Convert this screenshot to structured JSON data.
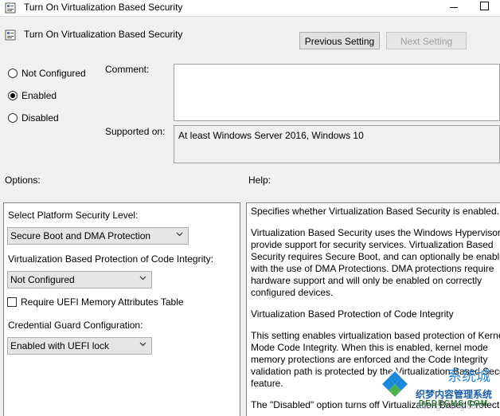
{
  "window": {
    "title": "Turn On Virtualization Based Security"
  },
  "header": {
    "title": "Turn On Virtualization Based Security",
    "prev_button": "Previous Setting",
    "next_button": "Next Setting"
  },
  "state": {
    "options": [
      "Not Configured",
      "Enabled",
      "Disabled"
    ],
    "selected": "Enabled"
  },
  "comment": {
    "label": "Comment:",
    "value": ""
  },
  "supported": {
    "label": "Supported on:",
    "value": "At least Windows Server 2016, Windows 10"
  },
  "options_pane": {
    "heading": "Options:",
    "platform_label": "Select Platform Security Level:",
    "platform_value": "Secure Boot and DMA Protection",
    "vbp_label": "Virtualization Based Protection of Code Integrity:",
    "vbp_value": "Not Configured",
    "uefi_checkbox_label": "Require UEFI Memory Attributes Table",
    "uefi_checked": false,
    "cred_label": "Credential Guard Configuration:",
    "cred_value": "Enabled with UEFI lock"
  },
  "help_pane": {
    "heading": "Help:",
    "paragraphs": [
      [
        "Specifies whether Virtualization Based Security is enabled."
      ],
      [
        "Virtualization Based Security uses the Windows Hypervisor t",
        "provide support for security services. Virtualization Based",
        "Security requires Secure Boot, and can optionally be enable",
        "with the use of DMA Protections. DMA protections require",
        "hardware support and will only be enabled on correctly",
        "configured devices."
      ],
      [
        "Virtualization Based Protection of Code Integrity"
      ],
      [
        "This setting enables virtualization based protection of Kerne",
        "Mode Code Integrity. When this is enabled, kernel mode",
        "memory protections are enforced and the Code Integrity",
        "validation path is protected by the Virtualization Based Secu",
        "feature."
      ],
      [
        "The \"Disabled\" option turns off Virtualization Based Protecti"
      ]
    ]
  },
  "watermark": {
    "logo_text": "系统城",
    "line1": "织梦内容管理系统",
    "line2": "DEDECMS.COM",
    "faint": "xitongcheng.com",
    "colors": {
      "blue": "#1e88d8",
      "green": "#4caf50"
    }
  }
}
